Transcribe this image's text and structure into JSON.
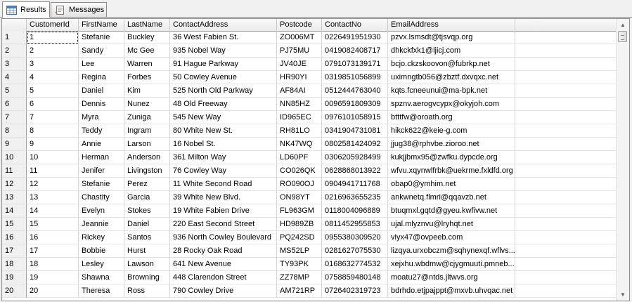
{
  "tabs": {
    "results_label": "Results",
    "messages_label": "Messages"
  },
  "columns": [
    "CustomerId",
    "FirstName",
    "LastName",
    "ContactAddress",
    "Postcode",
    "ContactNo",
    "EmailAddress"
  ],
  "rows": [
    [
      "1",
      "1",
      "Stefanie",
      "Buckley",
      "36 West Fabien St.",
      "ZO006MT",
      "0226491951930",
      "pzvx.lsmsdt@tjsvqp.org"
    ],
    [
      "2",
      "2",
      "Sandy",
      "Mc Gee",
      "935 Nobel Way",
      "PJ75MU",
      "0419082408717",
      "dhkckfxk1@ljicj.com"
    ],
    [
      "3",
      "3",
      "Lee",
      "Warren",
      "91 Hague Parkway",
      "JV40JE",
      "0791073139171",
      "bcjo.ckzskoovon@fubrkp.net"
    ],
    [
      "4",
      "4",
      "Regina",
      "Forbes",
      "50 Cowley Avenue",
      "HR90YI",
      "0319851056899",
      "uximngtb056@zbztf.dxvqxc.net"
    ],
    [
      "5",
      "5",
      "Daniel",
      "Kim",
      "525 North Old Parkway",
      "AF84AI",
      "0512444763040",
      "kqts.fcneeunui@ma-bpk.net"
    ],
    [
      "6",
      "6",
      "Dennis",
      "Nunez",
      "48 Old Freeway",
      "NN85HZ",
      "0096591809309",
      "spznv.aerogvcypx@okyjoh.com"
    ],
    [
      "7",
      "7",
      "Myra",
      "Zuniga",
      "545 New Way",
      "ID965EC",
      "0976101058915",
      "btttfw@oroath.org"
    ],
    [
      "8",
      "8",
      "Teddy",
      "Ingram",
      "80 White New St.",
      "RH81LO",
      "0341904731081",
      "hikck622@keie-g.com"
    ],
    [
      "9",
      "9",
      "Annie",
      "Larson",
      "16 Nobel St.",
      "NK47WQ",
      "0802581424092",
      "jjug38@rphvbe.zioroo.net"
    ],
    [
      "10",
      "10",
      "Herman",
      "Anderson",
      "361 Milton Way",
      "LD60PF",
      "0306205928499",
      "kukjjbmx95@zwfku.dypcde.org"
    ],
    [
      "11",
      "11",
      "Jenifer",
      "Livingston",
      "76 Cowley Way",
      "CO026QK",
      "0628868013922",
      "wfvu.xqynwlfrbk@uekrme.fxldfd.org"
    ],
    [
      "12",
      "12",
      "Stefanie",
      "Perez",
      "11 White Second Road",
      "RO090OJ",
      "0904941711768",
      "obap0@ymhim.net"
    ],
    [
      "13",
      "13",
      "Chastity",
      "Garcia",
      "39 White New Blvd.",
      "ON98YT",
      "0216963655235",
      "ankwnetq.flmri@qqavzb.net"
    ],
    [
      "14",
      "14",
      "Evelyn",
      "Stokes",
      "19 White Fabien Drive",
      "FL963GM",
      "0118004096889",
      "btuqmxl.gqtd@gyeu.kwfivw.net"
    ],
    [
      "15",
      "15",
      "Jeannie",
      "Daniel",
      "220 East Second Street",
      "HD989ZB",
      "0811452955853",
      "ujal.mlyznvu@lryhqt.net"
    ],
    [
      "16",
      "16",
      "Rickey",
      "Santos",
      "936 North Cowley Boulevard",
      "PQ242SD",
      "0955380309520",
      "viyx47@ovpeeb.com"
    ],
    [
      "17",
      "17",
      "Bobbie",
      "Hurst",
      "28 Rocky Oak Road",
      "MS52LP",
      "0281627075530",
      "lizqya.urxobczm@sqhynexqf.wflvs..."
    ],
    [
      "18",
      "18",
      "Lesley",
      "Lawson",
      "641 New Avenue",
      "TY93PK",
      "0168632774532",
      "xejxhu.wbdmw@cjygmuuti.pmneb..."
    ],
    [
      "19",
      "19",
      "Shawna",
      "Browning",
      "448 Clarendon Street",
      "ZZ78MP",
      "0758859480148",
      "moatu27@ntds.jltwvs.org"
    ],
    [
      "20",
      "20",
      "Theresa",
      "Ross",
      "790 Cowley Drive",
      "AM721RP",
      "0726402319723",
      "bdrhdo.etjpajppt@mxvb.uhvqac.net"
    ]
  ]
}
